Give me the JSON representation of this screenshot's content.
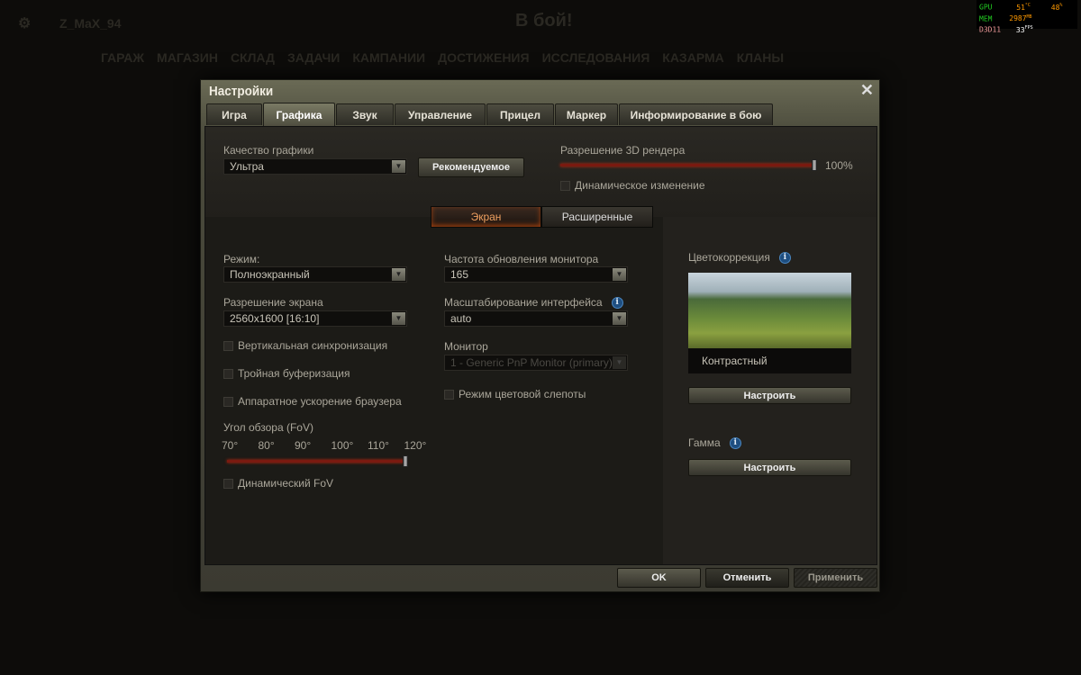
{
  "background": {
    "player": "Z_MaX_94",
    "battle_button": "В бой!",
    "nav": [
      "ГАРАЖ",
      "МАГАЗИН",
      "СКЛАД",
      "ЗАДАЧИ",
      "КАМПАНИИ",
      "ДОСТИЖЕНИЯ",
      "ИССЛЕДОВАНИЯ",
      "КАЗАРМА",
      "КЛАНЫ"
    ]
  },
  "hud": {
    "gpu_label": "GPU",
    "gpu_temp": "51",
    "gpu_temp_unit": "°C",
    "gpu_load": "48",
    "gpu_load_unit": "%",
    "mem_label": "MEM",
    "mem_value": "2987",
    "mem_unit": "MB",
    "api": "D3D11",
    "fps": "33",
    "fps_unit": "FPS"
  },
  "dialog": {
    "title": "Настройки",
    "tabs": [
      "Игра",
      "Графика",
      "Звук",
      "Управление",
      "Прицел",
      "Маркер",
      "Информирование в бою"
    ],
    "quality": {
      "label": "Качество графики",
      "value": "Ультра",
      "recommended": "Рекомендуемое"
    },
    "render": {
      "label": "Разрешение 3D рендера",
      "value_text": "100%",
      "value": 100,
      "dynamic": "Динамическое изменение"
    },
    "subtabs": [
      "Экран",
      "Расширенные"
    ],
    "mode": {
      "label": "Режим:",
      "value": "Полноэкранный"
    },
    "resolution": {
      "label": "Разрешение экрана",
      "value": "2560x1600 [16:10]"
    },
    "vsync": "Вертикальная синхронизация",
    "triple": "Тройная буферизация",
    "hwaccel": "Аппаратное ускорение браузера",
    "fov": {
      "label": "Угол обзора (FoV)",
      "ticks": [
        "70°",
        "80°",
        "90°",
        "100°",
        "110°",
        "120°"
      ],
      "value": 120,
      "min": 70,
      "max": 120,
      "dynamic": "Динамический FoV"
    },
    "refresh": {
      "label": "Частота обновления монитора",
      "value": "165"
    },
    "scaling": {
      "label": "Масштабирование интерфейса",
      "value": "auto"
    },
    "monitor": {
      "label": "Монитор",
      "value": "1 - Generic PnP Monitor (primary)"
    },
    "colorblind": "Режим цветовой слепоты",
    "color_correction": {
      "label": "Цветокоррекция",
      "preset": "Контрастный",
      "button": "Настроить"
    },
    "gamma": {
      "label": "Гамма",
      "button": "Настроить"
    },
    "footer": {
      "ok": "OK",
      "cancel": "Отменить",
      "apply": "Применить"
    }
  }
}
